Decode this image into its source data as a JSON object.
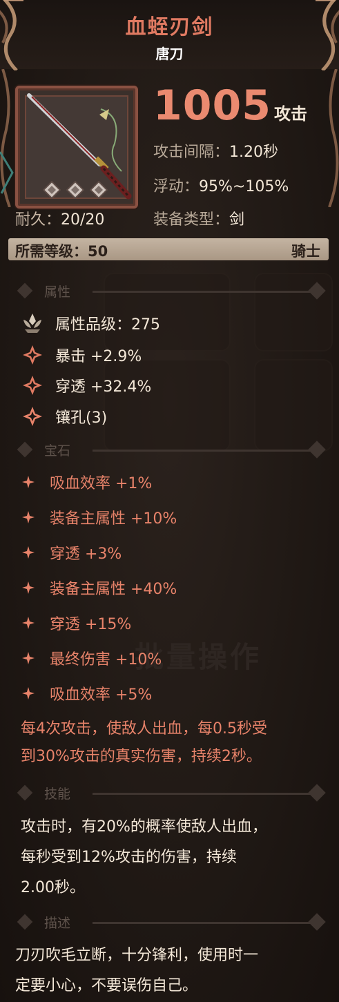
{
  "item": {
    "name": "血蛭刃剑",
    "type": "唐刀",
    "attack_value": "1005",
    "attack_unit": "攻击",
    "interval_label": "攻击间隔：",
    "interval_value": "1.20秒",
    "float_label": "浮动：",
    "float_value": "95%~105%",
    "durability_label": "耐久：",
    "durability_value": "20/20",
    "equip_type_label": "装备类型：",
    "equip_type_value": "剑",
    "requirement_label": "所需等级：50",
    "requirement_class": "骑士"
  },
  "sections": {
    "attributes": "属性",
    "gems": "宝石",
    "skill": "技能",
    "description": "描述"
  },
  "attributes": [
    {
      "icon": "lotus-crest-icon",
      "text": "属性品级：275"
    },
    {
      "icon": "critical-star-icon",
      "text": "暴击 +2.9%"
    },
    {
      "icon": "penetrate-star-icon",
      "text": "穿透 +32.4%"
    },
    {
      "icon": "socket-star-icon",
      "text": "镶孔(3)"
    }
  ],
  "gems": [
    "吸血效率 +1%",
    "装备主属性 +10%",
    "穿透 +3%",
    "装备主属性 +40%",
    "穿透 +15%",
    "最终伤害 +10%",
    "吸血效率 +5%"
  ],
  "special_effect": [
    "每4次攻击，使敌人出血，每0.5秒受",
    "到30%攻击的真实伤害，持续2秒。"
  ],
  "skill_text": [
    "攻击时，有20%的概率使敌人出血，",
    "每秒受到12%攻击的伤害，持续",
    "2.00秒。"
  ],
  "description_text": [
    "刀刃吹毛立断，十分锋利，使用时一",
    "定要小心，不要误伤自己。"
  ],
  "background_watermark": "批量操作",
  "colors": {
    "accent": "#ea8a70",
    "gem_text": "#e8836a",
    "text": "#f3e7d7"
  }
}
